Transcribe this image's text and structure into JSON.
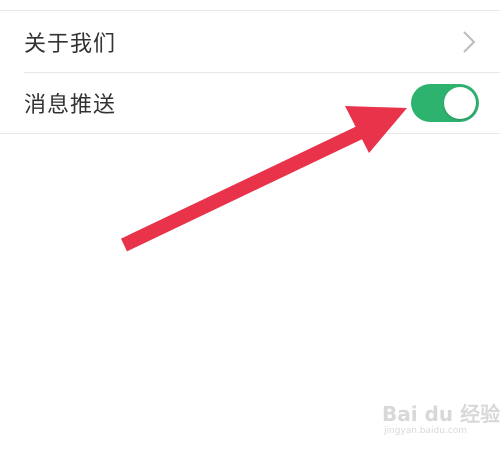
{
  "settings": {
    "items": [
      {
        "label": "关于我们",
        "control": "chevron-right-icon"
      },
      {
        "label": "消息推送",
        "control": "toggle",
        "toggle_on": true
      }
    ]
  },
  "colors": {
    "toggle_on": "#2eb36f",
    "arrow": "#e8334a",
    "text": "#333333",
    "divider": "#e8e8e8"
  },
  "watermark": {
    "brand": "Bai du 经验",
    "url": "jingyan.baidu.com"
  }
}
